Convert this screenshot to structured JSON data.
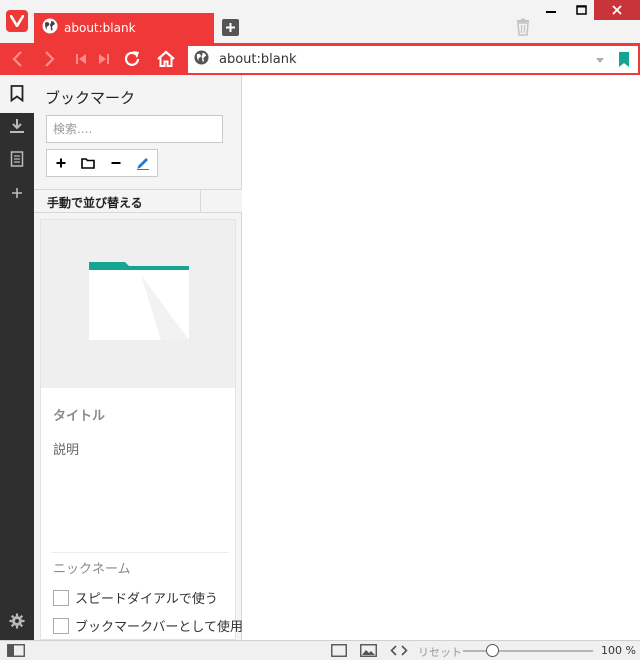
{
  "tab": {
    "title": "about:blank"
  },
  "address": {
    "url": "about:blank"
  },
  "panel": {
    "title": "ブックマーク",
    "search_placeholder": "検索....",
    "sort_label": "手動で並び替える",
    "field_title": "タイトル",
    "field_description": "説明",
    "field_nickname": "ニックネーム",
    "checkbox_speed_dial": "スピードダイアルで使う",
    "checkbox_bookmark_bar": "ブックマークバーとして使用"
  },
  "status": {
    "reset_label": "リセット",
    "zoom_value": "100 %",
    "zoom_level": 0.23
  },
  "colors": {
    "accent": "#ef3939",
    "teal": "#16a594",
    "strip": "#2f2f2f"
  },
  "icons": {
    "logo": "vivaldi-logo-icon",
    "tab": "globe-icon",
    "new_tab": "plus-icon",
    "trash": "trash-icon",
    "back": "arrow-left-icon",
    "forward": "arrow-right-icon",
    "rewind": "rewind-icon",
    "fast_forward": "fast-forward-icon",
    "reload": "reload-icon",
    "home": "home-icon"
  }
}
